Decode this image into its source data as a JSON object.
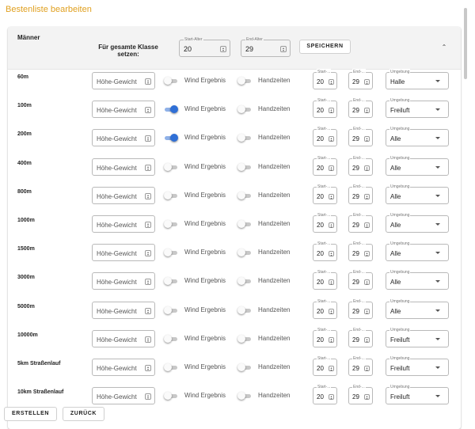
{
  "page": {
    "title": "Bestenliste bearbeiten"
  },
  "class": {
    "name": "Männer",
    "set_label": "Für gesamte Klasse setzen:",
    "start_label": "Start-Alter",
    "start_value": "20",
    "end_label": "End-Alter",
    "end_value": "29",
    "save_label": "SPEICHERN",
    "collapse_icon": "chevron-up-icon"
  },
  "row_labels": {
    "weight": "Höhe-Gewicht",
    "wind": "Wind Ergebnis",
    "hand": "Handzeiten",
    "start": "Start-...",
    "end": "End-...",
    "env": "Umgebung"
  },
  "rows": [
    {
      "discipline": "60m",
      "wind": false,
      "hand": false,
      "start": "20",
      "end": "29",
      "env": "Halle"
    },
    {
      "discipline": "100m",
      "wind": true,
      "hand": false,
      "start": "20",
      "end": "29",
      "env": "Freiluft"
    },
    {
      "discipline": "200m",
      "wind": true,
      "hand": false,
      "start": "20",
      "end": "29",
      "env": "Alle"
    },
    {
      "discipline": "400m",
      "wind": false,
      "hand": false,
      "start": "20",
      "end": "29",
      "env": "Alle"
    },
    {
      "discipline": "800m",
      "wind": false,
      "hand": false,
      "start": "20",
      "end": "29",
      "env": "Alle"
    },
    {
      "discipline": "1000m",
      "wind": false,
      "hand": false,
      "start": "20",
      "end": "29",
      "env": "Alle"
    },
    {
      "discipline": "1500m",
      "wind": false,
      "hand": false,
      "start": "20",
      "end": "29",
      "env": "Alle"
    },
    {
      "discipline": "3000m",
      "wind": false,
      "hand": false,
      "start": "20",
      "end": "29",
      "env": "Alle"
    },
    {
      "discipline": "5000m",
      "wind": false,
      "hand": false,
      "start": "20",
      "end": "29",
      "env": "Alle"
    },
    {
      "discipline": "10000m",
      "wind": false,
      "hand": false,
      "start": "20",
      "end": "29",
      "env": "Freiluft"
    },
    {
      "discipline": "5km Straßenlauf",
      "wind": false,
      "hand": false,
      "start": "20",
      "end": "29",
      "env": "Freiluft"
    },
    {
      "discipline": "10km Straßenlauf",
      "wind": false,
      "hand": false,
      "start": "20",
      "end": "29",
      "env": "Freiluft"
    }
  ],
  "footer": {
    "create_label": "ERSTELLEN",
    "back_label": "ZURÜCK"
  },
  "colors": {
    "title": "#e0a020",
    "toggle_on": "#2f6fd6",
    "header_bg": "#f3f3f3"
  }
}
